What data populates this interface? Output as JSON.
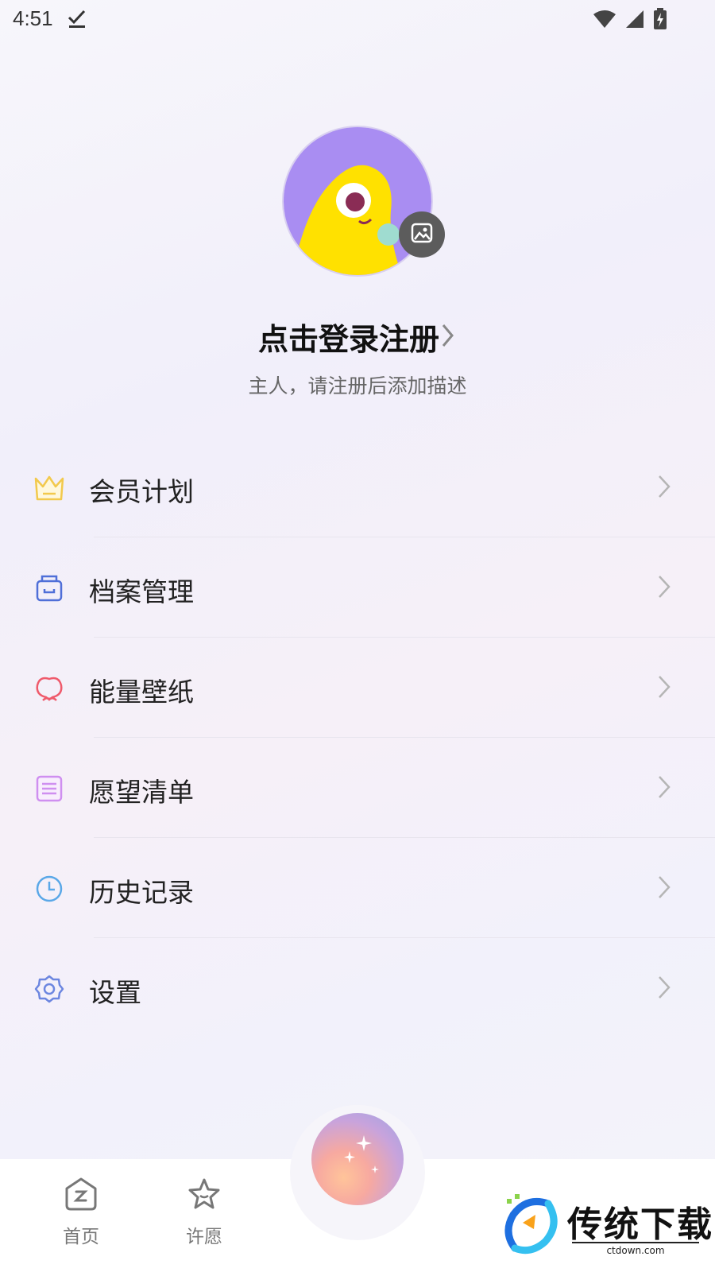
{
  "status_bar": {
    "time": "4:51"
  },
  "profile": {
    "title": "点击登录注册",
    "subtitle": "主人，请注册后添加描述"
  },
  "menu": [
    {
      "label": "会员计划",
      "icon": "crown-icon",
      "color": "#f2c94c"
    },
    {
      "label": "档案管理",
      "icon": "archive-box-icon",
      "color": "#4f6fd8"
    },
    {
      "label": "能量壁纸",
      "icon": "peach-icon",
      "color": "#ef5a6b"
    },
    {
      "label": "愿望清单",
      "icon": "list-icon",
      "color": "#cf8ff0"
    },
    {
      "label": "历史记录",
      "icon": "clock-icon",
      "color": "#5aa8e8"
    },
    {
      "label": "设置",
      "icon": "gear-icon",
      "color": "#6c86e0"
    }
  ],
  "tabbar": {
    "tabs": [
      {
        "label": "首页",
        "icon": "home-icon"
      },
      {
        "label": "许愿",
        "icon": "star-icon"
      }
    ]
  },
  "watermark": {
    "text": "传统下载",
    "url": "ctdown.com"
  }
}
